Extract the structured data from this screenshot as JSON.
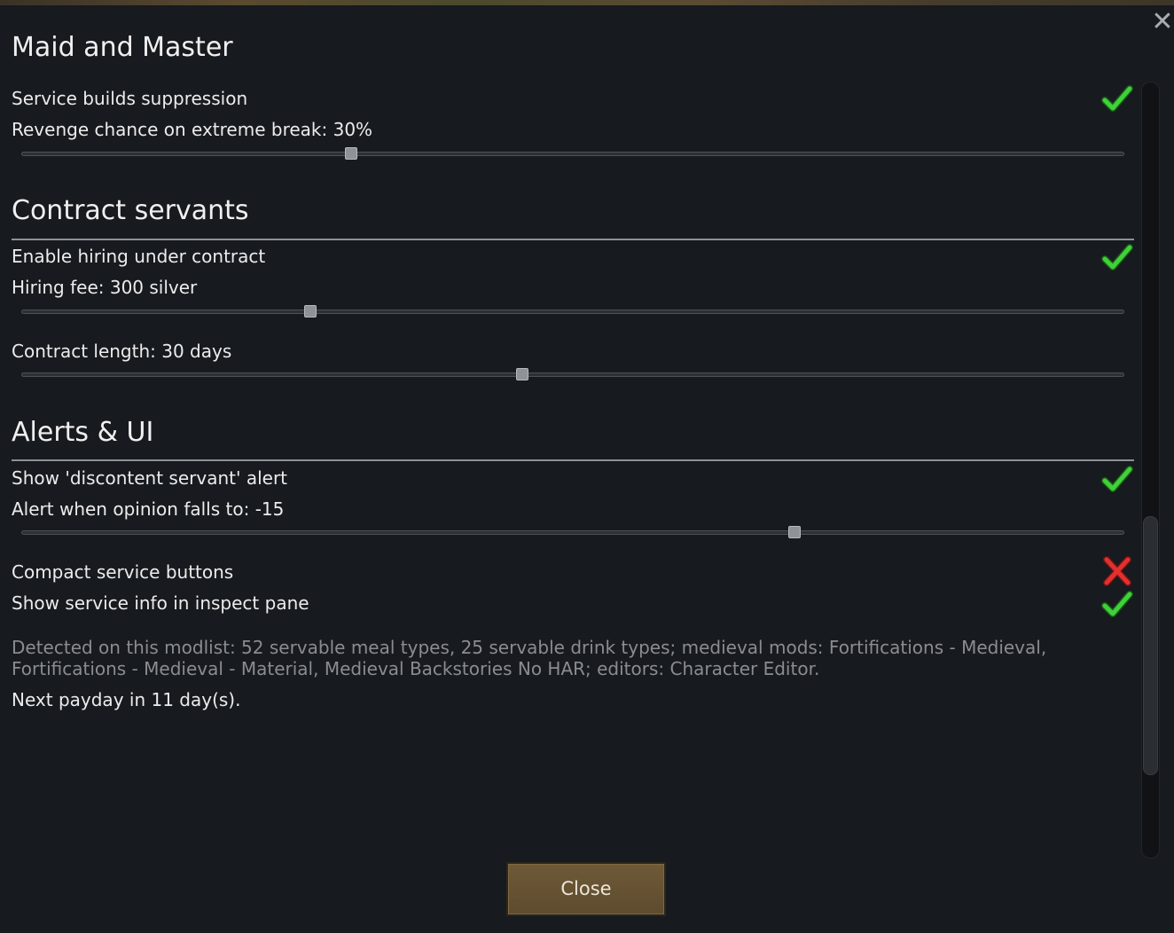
{
  "sections": [
    {
      "title": "Maid and Master",
      "rows": [
        {
          "type": "checkbox",
          "label": "Service builds suppression",
          "checked": true
        },
        {
          "type": "slider",
          "label": "Revenge chance on extreme break: 30%",
          "fraction": 0.3
        }
      ]
    },
    {
      "title": "Contract servants",
      "rows": [
        {
          "type": "checkbox",
          "label": "Enable hiring under contract",
          "checked": true
        },
        {
          "type": "slider",
          "label": "Hiring fee: 300 silver",
          "fraction": 0.26
        },
        {
          "type": "slider",
          "label": "Contract length: 30 days",
          "fraction": 0.455
        }
      ]
    },
    {
      "title": "Alerts & UI",
      "rows": [
        {
          "type": "checkbox",
          "label": "Show 'discontent servant' alert",
          "checked": true
        },
        {
          "type": "slider",
          "label": "Alert when opinion falls to: -15",
          "fraction": 0.7
        },
        {
          "type": "checkbox",
          "label": "Compact service buttons",
          "checked": false
        },
        {
          "type": "checkbox",
          "label": "Show service info in inspect pane",
          "checked": true
        }
      ]
    }
  ],
  "info_text": "Detected on this modlist: 52 servable meal types, 25 servable drink types; medieval mods: Fortifications - Medieval, Fortifications - Medieval - Material, Medieval Backstories No HAR; editors: Character Editor.",
  "payday_text": "Next payday in 11 day(s).",
  "close_button_label": "Close",
  "close_icon": "close-x-icon",
  "colors": {
    "check_green": "#3fd13a",
    "cross_red": "#e2302f",
    "button_brown": "#6e5a38"
  }
}
